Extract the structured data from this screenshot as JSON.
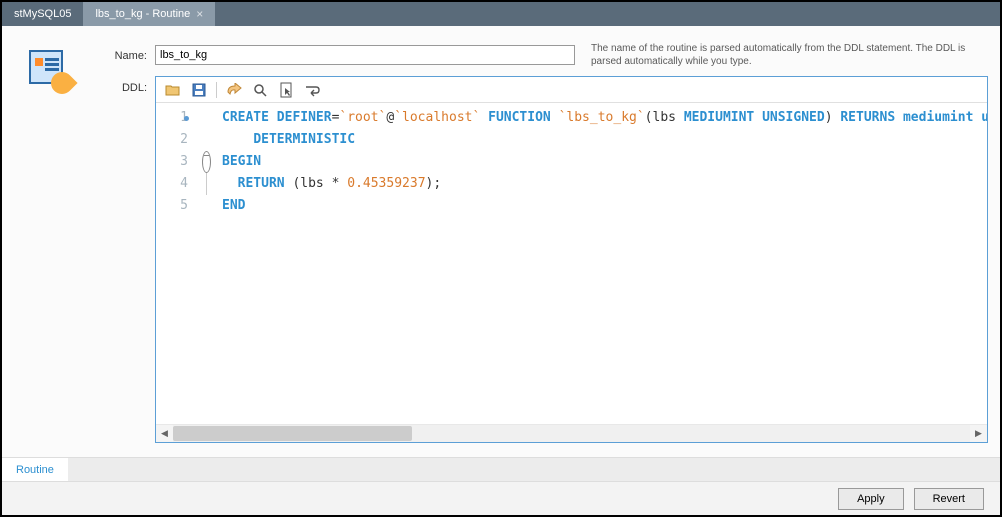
{
  "tabs": [
    {
      "label": "stMySQL05",
      "active": false
    },
    {
      "label": "lbs_to_kg - Routine",
      "active": true
    }
  ],
  "form": {
    "name_label": "Name:",
    "name_value": "lbs_to_kg",
    "hint": "The name of the routine is parsed automatically from the DDL statement. The DDL is parsed automatically while you type.",
    "ddl_label": "DDL:"
  },
  "toolbar_icons": [
    "open-icon",
    "save-icon",
    "undo-icon",
    "search-icon",
    "click-icon",
    "wrap-icon"
  ],
  "code": {
    "lines": [
      {
        "n": 1,
        "tokens": [
          [
            "kw",
            "CREATE DEFINER"
          ],
          [
            "",
            "="
          ],
          [
            "str",
            "`root`"
          ],
          [
            "",
            "@"
          ],
          [
            "str",
            "`localhost`"
          ],
          [
            "",
            " "
          ],
          [
            "kw",
            "FUNCTION"
          ],
          [
            "",
            " "
          ],
          [
            "str",
            "`lbs_to_kg`"
          ],
          [
            "",
            "(lbs "
          ],
          [
            "kw",
            "MEDIUMINT UNSIGNED"
          ],
          [
            "",
            ") "
          ],
          [
            "kw",
            "RETURNS mediumint unsigned"
          ]
        ]
      },
      {
        "n": 2,
        "tokens": [
          [
            "",
            "    "
          ],
          [
            "kw",
            "DETERMINISTIC"
          ]
        ]
      },
      {
        "n": 3,
        "tokens": [
          [
            "kw",
            "BEGIN"
          ]
        ]
      },
      {
        "n": 4,
        "tokens": [
          [
            "",
            "  "
          ],
          [
            "kw",
            "RETURN"
          ],
          [
            "",
            " (lbs * "
          ],
          [
            "num",
            "0.45359237"
          ],
          [
            "",
            ");"
          ]
        ]
      },
      {
        "n": 5,
        "tokens": [
          [
            "kw",
            "END"
          ]
        ]
      }
    ]
  },
  "bottom_tab": "Routine",
  "buttons": {
    "apply": "Apply",
    "revert": "Revert"
  }
}
